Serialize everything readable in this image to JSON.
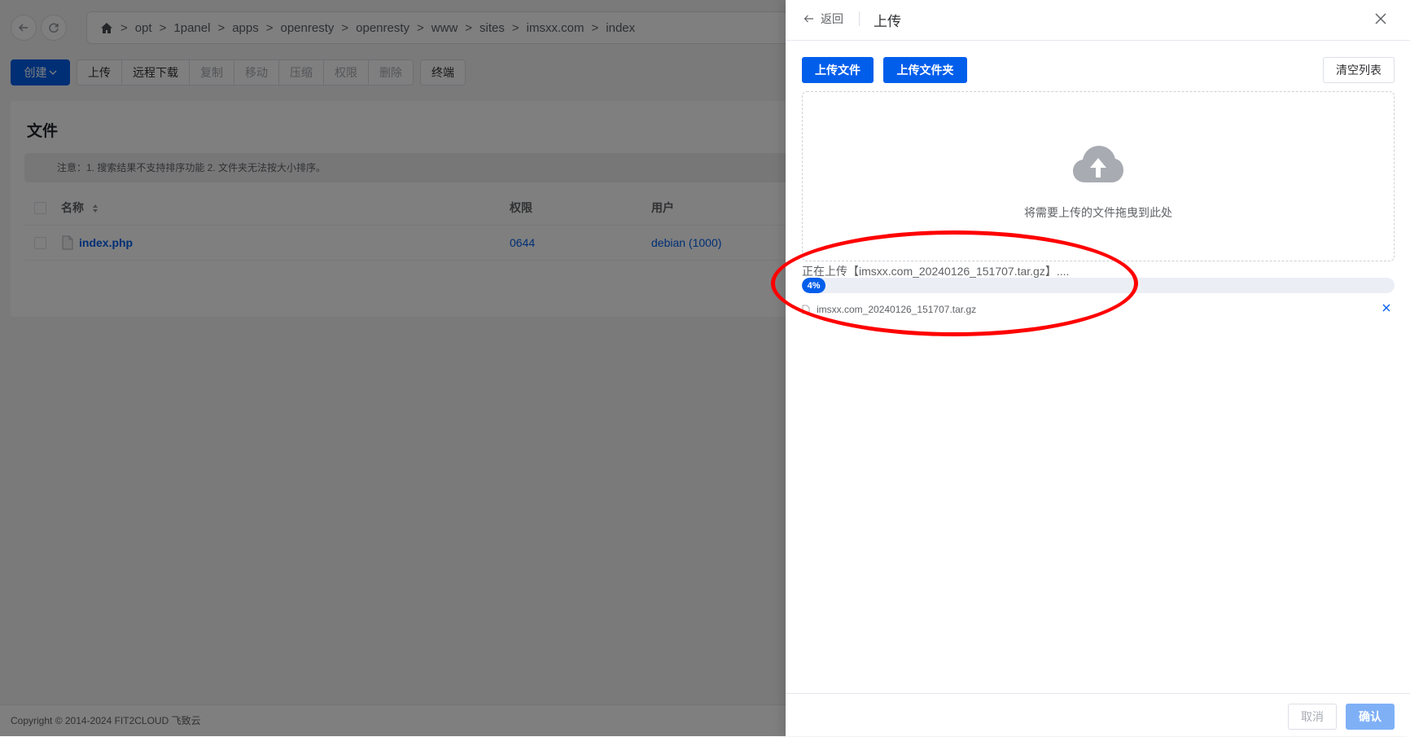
{
  "breadcrumb": {
    "items": [
      "opt",
      "1panel",
      "apps",
      "openresty",
      "openresty",
      "www",
      "sites",
      "imsxx.com",
      "index"
    ],
    "separator": ">"
  },
  "toolbar": {
    "create_label": "创建",
    "upload_label": "上传",
    "remote_download_label": "远程下载",
    "copy_label": "复制",
    "move_label": "移动",
    "compress_label": "压缩",
    "permission_label": "权限",
    "delete_label": "删除",
    "terminal_label": "终端"
  },
  "files": {
    "title": "文件",
    "notice": "注意：1. 搜索结果不支持排序功能 2. 文件夹无法按大小排序。",
    "columns": {
      "name": "名称",
      "permission": "权限",
      "user": "用户"
    },
    "rows": [
      {
        "name": "index.php",
        "permission": "0644",
        "user": "debian (1000)"
      }
    ]
  },
  "footer": {
    "copyright": "Copyright © 2014-2024 FIT2CLOUD 飞致云"
  },
  "drawer": {
    "back_label": "返回",
    "title": "上传",
    "upload_file_label": "上传文件",
    "upload_folder_label": "上传文件夹",
    "clear_list_label": "清空列表",
    "drop_hint": "将需要上传的文件拖曳到此处",
    "status_text": "正在上传【imsxx.com_20240126_151707.tar.gz】....",
    "progress_percent": 4,
    "progress_label": "4%",
    "file_name": "imsxx.com_20240126_151707.tar.gz",
    "cancel_label": "取消",
    "confirm_label": "确认"
  },
  "colors": {
    "primary": "#005eeb",
    "primary_disabled": "#7fb0f6",
    "annotation": "#ff0000"
  },
  "icons": [
    "back-arrow-icon",
    "refresh-icon",
    "home-icon",
    "chevron-down-icon",
    "sort-icon",
    "file-icon",
    "close-icon",
    "cloud-upload-icon",
    "remove-icon"
  ]
}
